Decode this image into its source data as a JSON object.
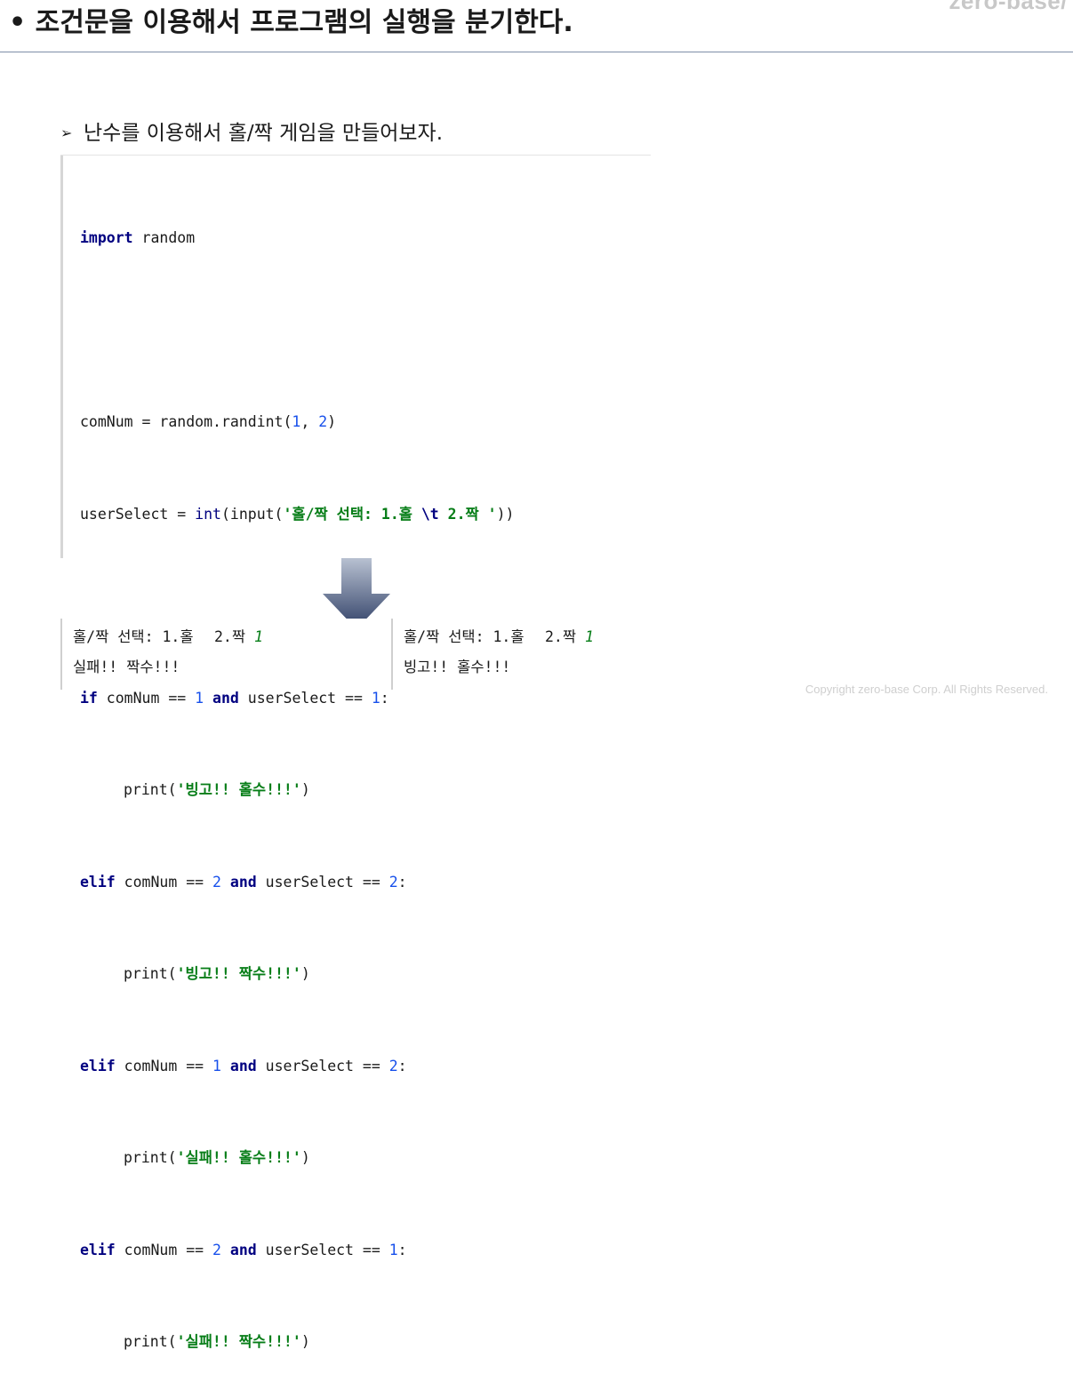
{
  "logo": "zero-base/",
  "slide_title": "• 조건문을 이용해서 프로그램의 실행을 분기한다.",
  "bullet": {
    "marker": "➢",
    "text": "난수를 이용해서 홀/짝 게임을 만들어보자."
  },
  "code": {
    "l1_kw": "import",
    "l1_rest": " random",
    "l3_a": "comNum = random.randint(",
    "l3_n1": "1",
    "l3_sep": ", ",
    "l3_n2": "2",
    "l3_b": ")",
    "l4_a": "userSelect = ",
    "l4_int": "int",
    "l4_b": "(input(",
    "l4_s1": "'홀/짝 선택: 1.홀 ",
    "l4_esc": "\\t",
    "l4_s2": " 2.짝 '",
    "l4_c": "))",
    "l6_kw": "if",
    "l6_a": " comNum == ",
    "l6_n1": "1",
    "l6_and": "and",
    "l6_b": " userSelect == ",
    "l6_n2": "1",
    "l6_c": ":",
    "l7_a": "print(",
    "l7_s": "'빙고!! 홀수!!!'",
    "l7_b": ")",
    "l8_kw": "elif",
    "l8_a": " comNum == ",
    "l8_n1": "2",
    "l8_and": "and",
    "l8_b": " userSelect == ",
    "l8_n2": "2",
    "l8_c": ":",
    "l9_a": "print(",
    "l9_s": "'빙고!! 짝수!!!'",
    "l9_b": ")",
    "l10_kw": "elif",
    "l10_a": " comNum == ",
    "l10_n1": "1",
    "l10_and": "and",
    "l10_b": " userSelect == ",
    "l10_n2": "2",
    "l10_c": ":",
    "l11_a": "print(",
    "l11_s": "'실패!! 홀수!!!'",
    "l11_b": ")",
    "l12_kw": "elif",
    "l12_a": " comNum == ",
    "l12_n1": "2",
    "l12_and": "and",
    "l12_b": " userSelect == ",
    "l12_n2": "1",
    "l12_c": ":",
    "l13_a": "print(",
    "l13_s": "'실패!! 짝수!!!'",
    "l13_b": ")"
  },
  "output_left": {
    "prompt": "홀/짝 선택: 1.홀\t2.짝 ",
    "input": "1",
    "result": "실패!! 짝수!!!"
  },
  "output_right": {
    "prompt": "홀/짝 선택: 1.홀\t2.짝 ",
    "input": "1",
    "result": "빙고!! 홀수!!!"
  },
  "copyright": "Copyright zero-base Corp. All Rights Reserved.",
  "colors": {
    "keyword": "#000080",
    "number": "#1750eb",
    "string": "#067d17",
    "arrow_top": "#b8c1d1",
    "arrow_bottom": "#2f3f66"
  }
}
